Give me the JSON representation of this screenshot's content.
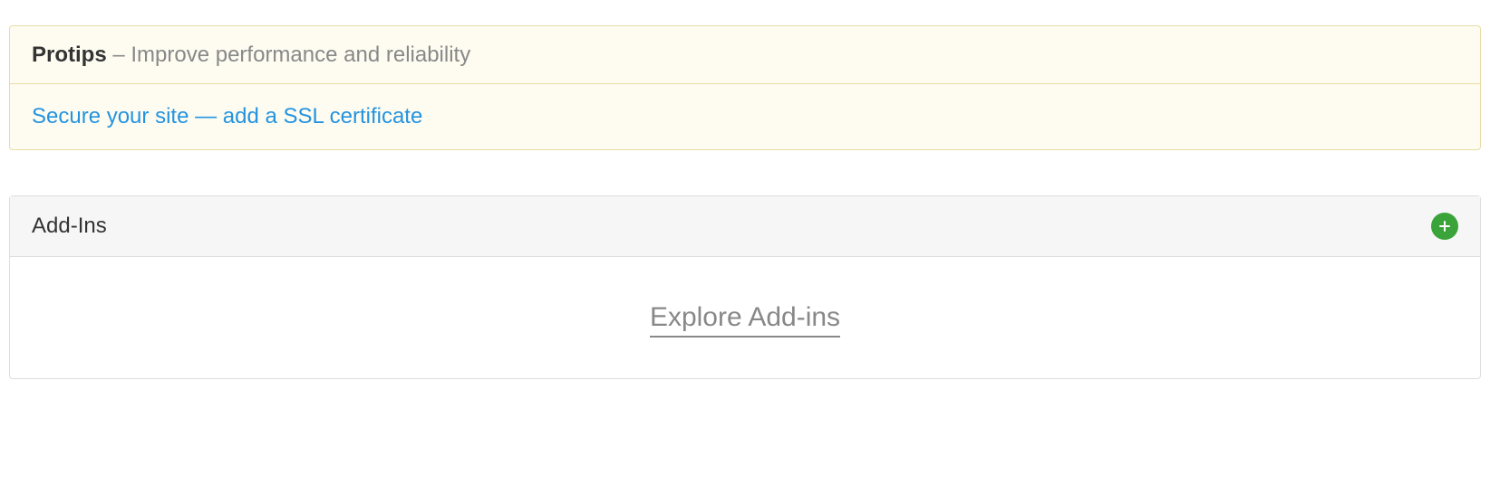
{
  "protips": {
    "title": "Protips",
    "separator": " – ",
    "subtitle": "Improve performance and reliability",
    "link_text": "Secure your site — add a SSL certificate"
  },
  "addins": {
    "title": "Add-Ins",
    "explore_link": "Explore Add-ins",
    "add_icon_name": "plus-icon"
  }
}
